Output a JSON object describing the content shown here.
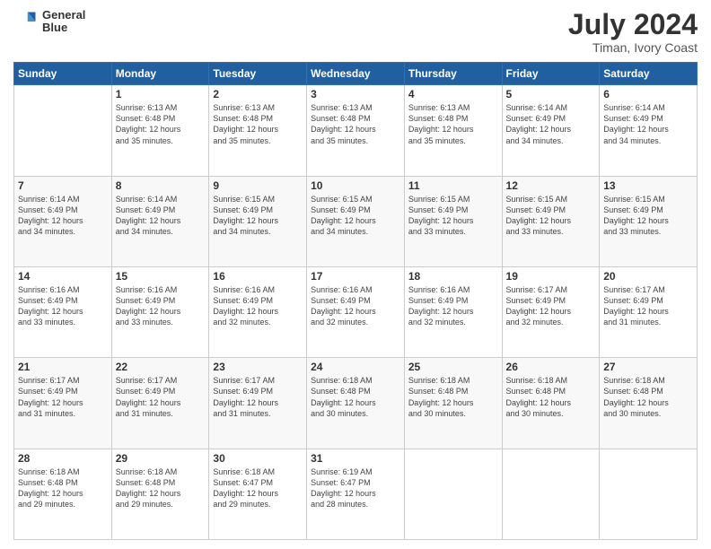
{
  "header": {
    "logo_line1": "General",
    "logo_line2": "Blue",
    "main_title": "July 2024",
    "subtitle": "Timan, Ivory Coast"
  },
  "calendar": {
    "days_of_week": [
      "Sunday",
      "Monday",
      "Tuesday",
      "Wednesday",
      "Thursday",
      "Friday",
      "Saturday"
    ],
    "weeks": [
      [
        {
          "day": "",
          "info": ""
        },
        {
          "day": "1",
          "info": "Sunrise: 6:13 AM\nSunset: 6:48 PM\nDaylight: 12 hours\nand 35 minutes."
        },
        {
          "day": "2",
          "info": "Sunrise: 6:13 AM\nSunset: 6:48 PM\nDaylight: 12 hours\nand 35 minutes."
        },
        {
          "day": "3",
          "info": "Sunrise: 6:13 AM\nSunset: 6:48 PM\nDaylight: 12 hours\nand 35 minutes."
        },
        {
          "day": "4",
          "info": "Sunrise: 6:13 AM\nSunset: 6:48 PM\nDaylight: 12 hours\nand 35 minutes."
        },
        {
          "day": "5",
          "info": "Sunrise: 6:14 AM\nSunset: 6:49 PM\nDaylight: 12 hours\nand 34 minutes."
        },
        {
          "day": "6",
          "info": "Sunrise: 6:14 AM\nSunset: 6:49 PM\nDaylight: 12 hours\nand 34 minutes."
        }
      ],
      [
        {
          "day": "7",
          "info": "Sunrise: 6:14 AM\nSunset: 6:49 PM\nDaylight: 12 hours\nand 34 minutes."
        },
        {
          "day": "8",
          "info": "Sunrise: 6:14 AM\nSunset: 6:49 PM\nDaylight: 12 hours\nand 34 minutes."
        },
        {
          "day": "9",
          "info": "Sunrise: 6:15 AM\nSunset: 6:49 PM\nDaylight: 12 hours\nand 34 minutes."
        },
        {
          "day": "10",
          "info": "Sunrise: 6:15 AM\nSunset: 6:49 PM\nDaylight: 12 hours\nand 34 minutes."
        },
        {
          "day": "11",
          "info": "Sunrise: 6:15 AM\nSunset: 6:49 PM\nDaylight: 12 hours\nand 33 minutes."
        },
        {
          "day": "12",
          "info": "Sunrise: 6:15 AM\nSunset: 6:49 PM\nDaylight: 12 hours\nand 33 minutes."
        },
        {
          "day": "13",
          "info": "Sunrise: 6:15 AM\nSunset: 6:49 PM\nDaylight: 12 hours\nand 33 minutes."
        }
      ],
      [
        {
          "day": "14",
          "info": "Sunrise: 6:16 AM\nSunset: 6:49 PM\nDaylight: 12 hours\nand 33 minutes."
        },
        {
          "day": "15",
          "info": "Sunrise: 6:16 AM\nSunset: 6:49 PM\nDaylight: 12 hours\nand 33 minutes."
        },
        {
          "day": "16",
          "info": "Sunrise: 6:16 AM\nSunset: 6:49 PM\nDaylight: 12 hours\nand 32 minutes."
        },
        {
          "day": "17",
          "info": "Sunrise: 6:16 AM\nSunset: 6:49 PM\nDaylight: 12 hours\nand 32 minutes."
        },
        {
          "day": "18",
          "info": "Sunrise: 6:16 AM\nSunset: 6:49 PM\nDaylight: 12 hours\nand 32 minutes."
        },
        {
          "day": "19",
          "info": "Sunrise: 6:17 AM\nSunset: 6:49 PM\nDaylight: 12 hours\nand 32 minutes."
        },
        {
          "day": "20",
          "info": "Sunrise: 6:17 AM\nSunset: 6:49 PM\nDaylight: 12 hours\nand 31 minutes."
        }
      ],
      [
        {
          "day": "21",
          "info": "Sunrise: 6:17 AM\nSunset: 6:49 PM\nDaylight: 12 hours\nand 31 minutes."
        },
        {
          "day": "22",
          "info": "Sunrise: 6:17 AM\nSunset: 6:49 PM\nDaylight: 12 hours\nand 31 minutes."
        },
        {
          "day": "23",
          "info": "Sunrise: 6:17 AM\nSunset: 6:49 PM\nDaylight: 12 hours\nand 31 minutes."
        },
        {
          "day": "24",
          "info": "Sunrise: 6:18 AM\nSunset: 6:48 PM\nDaylight: 12 hours\nand 30 minutes."
        },
        {
          "day": "25",
          "info": "Sunrise: 6:18 AM\nSunset: 6:48 PM\nDaylight: 12 hours\nand 30 minutes."
        },
        {
          "day": "26",
          "info": "Sunrise: 6:18 AM\nSunset: 6:48 PM\nDaylight: 12 hours\nand 30 minutes."
        },
        {
          "day": "27",
          "info": "Sunrise: 6:18 AM\nSunset: 6:48 PM\nDaylight: 12 hours\nand 30 minutes."
        }
      ],
      [
        {
          "day": "28",
          "info": "Sunrise: 6:18 AM\nSunset: 6:48 PM\nDaylight: 12 hours\nand 29 minutes."
        },
        {
          "day": "29",
          "info": "Sunrise: 6:18 AM\nSunset: 6:48 PM\nDaylight: 12 hours\nand 29 minutes."
        },
        {
          "day": "30",
          "info": "Sunrise: 6:18 AM\nSunset: 6:47 PM\nDaylight: 12 hours\nand 29 minutes."
        },
        {
          "day": "31",
          "info": "Sunrise: 6:19 AM\nSunset: 6:47 PM\nDaylight: 12 hours\nand 28 minutes."
        },
        {
          "day": "",
          "info": ""
        },
        {
          "day": "",
          "info": ""
        },
        {
          "day": "",
          "info": ""
        }
      ]
    ]
  }
}
